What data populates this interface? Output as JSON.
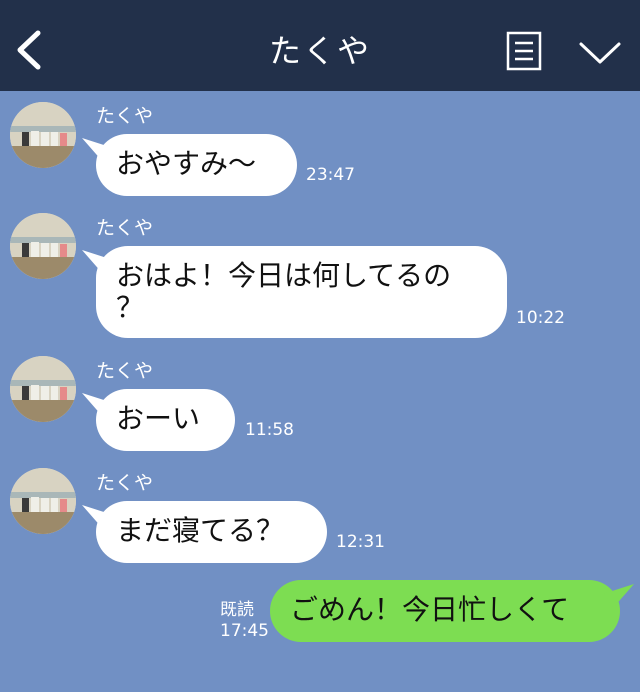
{
  "header": {
    "back_icon": "chevron-left-icon",
    "title": "たくや",
    "notes_icon": "notes-icon",
    "menu_icon": "chevron-down-icon",
    "bg": "#22304a"
  },
  "chat": {
    "bg": "#7190c4",
    "messages": [
      {
        "sender": "たくや",
        "text": "おやすみ〜",
        "time": "23:47"
      },
      {
        "sender": "たくや",
        "line1": "おはよ！今日は何してるの",
        "line2": "？",
        "time": "10:22"
      },
      {
        "sender": "たくや",
        "text": "おーい",
        "time": "11:58"
      },
      {
        "sender": "たくや",
        "text": "まだ寝てる？",
        "time": "12:31"
      }
    ],
    "outgoing": {
      "text": "ごめん！今日忙しくて",
      "read_label": "既読",
      "time": "17:45",
      "color": "#7ddd52"
    }
  }
}
